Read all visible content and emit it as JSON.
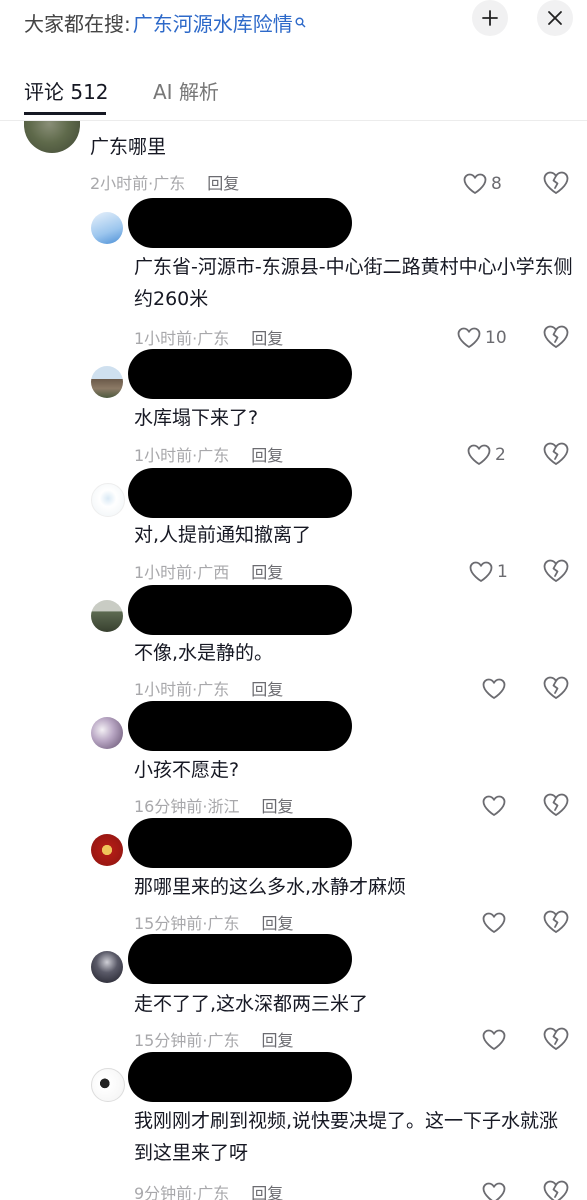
{
  "header": {
    "search_prefix": "大家都在搜:",
    "search_query": "广东河源水库险情",
    "collapse_icon": "collapse-icon",
    "close_icon": "close-icon"
  },
  "tabs": [
    {
      "label": "评论 512",
      "active": true
    },
    {
      "label": "AI 解析",
      "active": false
    }
  ],
  "reply_label": "回复",
  "comments": [
    {
      "text": "广东哪里",
      "time": "2小时前",
      "location": "广东",
      "meta": "2小时前·广东",
      "likes": "8"
    },
    {
      "text": "广东省-河源市-东源县-中心街二路黄村中心小学东侧约260米",
      "time": "1小时前",
      "location": "广东",
      "meta": "1小时前·广东",
      "likes": "10"
    },
    {
      "text": "水库塌下来了?",
      "time": "1小时前",
      "location": "广东",
      "meta": "1小时前·广东",
      "likes": "2"
    },
    {
      "text": "对,人提前通知撤离了",
      "time": "1小时前",
      "location": "广西",
      "meta": "1小时前·广西",
      "likes": "1"
    },
    {
      "text": "不像,水是静的。",
      "time": "1小时前",
      "location": "广东",
      "meta": "1小时前·广东",
      "likes": ""
    },
    {
      "text": "小孩不愿走?",
      "time": "16分钟前",
      "location": "浙江",
      "meta": "16分钟前·浙江",
      "likes": ""
    },
    {
      "text": "那哪里来的这么多水,水静才麻烦",
      "time": "15分钟前",
      "location": "广东",
      "meta": "15分钟前·广东",
      "likes": ""
    },
    {
      "text": "走不了了,这水深都两三米了",
      "time": "15分钟前",
      "location": "广东",
      "meta": "15分钟前·广东",
      "likes": ""
    },
    {
      "text": "我刚刚才刷到视频,说快要决堤了。这一下子水就涨到这里来了呀",
      "time": "9分钟前",
      "location": "广东",
      "meta": "9分钟前·广东",
      "likes": ""
    }
  ],
  "colors": {
    "search_query": "#2d69c9",
    "meta_text": "#a8a8ab",
    "reply_text": "#6b6b70",
    "redaction": "#000000"
  }
}
